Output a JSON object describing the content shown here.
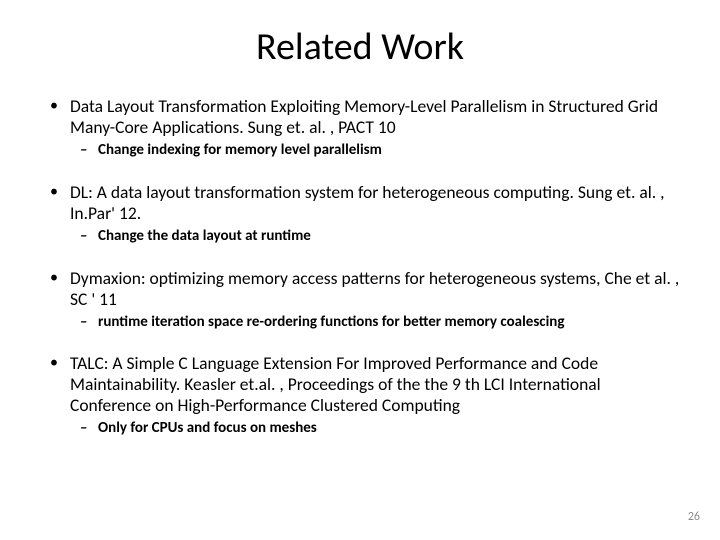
{
  "title": "Related Work",
  "items": [
    {
      "main": "Data Layout Transformation Exploiting Memory-Level Parallelism in Structured Grid Many-Core Applications. Sung et. al. , PACT 10",
      "sub": "Change indexing for memory level parallelism"
    },
    {
      "main": "DL: A data layout transformation system for heterogeneous computing. Sung et. al. , In.Par' 12.",
      "sub": "Change the data layout at runtime"
    },
    {
      "main": "Dymaxion: optimizing memory access patterns for heterogeneous systems, Che et al. , SC ' 11",
      "sub": "runtime iteration space re-ordering functions for better memory coalescing"
    },
    {
      "main": "TALC: A Simple C Language Extension For Improved Performance and Code Maintainability. Keasler et.al. , Proceedings of the the 9 th LCI International Conference on High-Performance Clustered Computing",
      "sub": "Only for CPUs and focus on meshes"
    }
  ],
  "pageNumber": "26"
}
